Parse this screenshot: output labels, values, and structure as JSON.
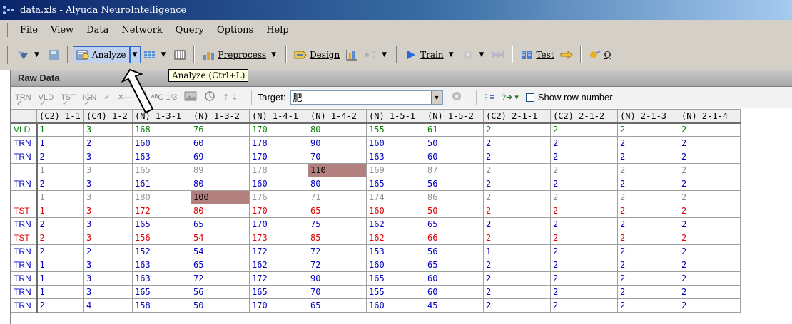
{
  "window": {
    "title": "data.xls - Alyuda NeuroIntelligence"
  },
  "menu": [
    "File",
    "View",
    "Data",
    "Network",
    "Query",
    "Options",
    "Help"
  ],
  "toolbar": {
    "analyze_label": "Analyze",
    "preprocess_label": "Preprocess",
    "design_label": "Design",
    "train_label": "Train",
    "test_label": "Test",
    "query_label": "Q"
  },
  "tooltip": "Analyze (Ctrl+L)",
  "panel": {
    "title": "Raw Data",
    "tool_labels": [
      "TRN",
      "VLD",
      "TST",
      "IGN"
    ],
    "target_label": "Target:",
    "target_value": "肥",
    "show_row_numbers_label": "Show row number"
  },
  "columns": [
    "(C2) 1-1",
    "(C4) 1-2",
    "(N) 1-3-1",
    "(N) 1-3-2",
    "(N) 1-4-1",
    "(N) 1-4-2",
    "(N) 1-5-1",
    "(N) 1-5-2",
    "(C2) 2-1-1",
    "(C2) 2-1-2",
    "(N) 2-1-3",
    "(N) 2-1-4"
  ],
  "rows": [
    {
      "label": "VLD",
      "set": "vld",
      "cells": [
        "1",
        "3",
        "168",
        "76",
        "170",
        "80",
        "155",
        "61",
        "2",
        "2",
        "2",
        "2"
      ]
    },
    {
      "label": "TRN",
      "set": "trn",
      "cells": [
        "1",
        "2",
        "160",
        "60",
        "178",
        "90",
        "160",
        "50",
        "2",
        "2",
        "2",
        "2"
      ]
    },
    {
      "label": "TRN",
      "set": "trn",
      "cells": [
        "2",
        "3",
        "163",
        "69",
        "170",
        "70",
        "163",
        "60",
        "2",
        "2",
        "2",
        "2"
      ]
    },
    {
      "label": "",
      "set": "none",
      "highlight": 5,
      "cells": [
        "1",
        "3",
        "165",
        "89",
        "178",
        "110",
        "169",
        "87",
        "2",
        "2",
        "2",
        "2"
      ]
    },
    {
      "label": "TRN",
      "set": "trn",
      "cells": [
        "2",
        "3",
        "161",
        "80",
        "160",
        "80",
        "165",
        "56",
        "2",
        "2",
        "2",
        "2"
      ]
    },
    {
      "label": "",
      "set": "none",
      "highlight": 3,
      "cells": [
        "1",
        "3",
        "180",
        "100",
        "176",
        "71",
        "174",
        "86",
        "2",
        "2",
        "2",
        "2"
      ]
    },
    {
      "label": "TST",
      "set": "tst",
      "cells": [
        "1",
        "3",
        "172",
        "80",
        "170",
        "65",
        "160",
        "50",
        "2",
        "2",
        "2",
        "2"
      ]
    },
    {
      "label": "TRN",
      "set": "trn",
      "cells": [
        "2",
        "3",
        "165",
        "65",
        "170",
        "75",
        "162",
        "65",
        "2",
        "2",
        "2",
        "2"
      ]
    },
    {
      "label": "TST",
      "set": "tst",
      "cells": [
        "2",
        "3",
        "156",
        "54",
        "173",
        "85",
        "162",
        "66",
        "2",
        "2",
        "2",
        "2"
      ]
    },
    {
      "label": "TRN",
      "set": "trn",
      "cells": [
        "2",
        "2",
        "152",
        "54",
        "172",
        "72",
        "153",
        "56",
        "1",
        "2",
        "2",
        "2"
      ]
    },
    {
      "label": "TRN",
      "set": "trn",
      "cells": [
        "1",
        "3",
        "163",
        "65",
        "162",
        "72",
        "160",
        "65",
        "2",
        "2",
        "2",
        "2"
      ]
    },
    {
      "label": "TRN",
      "set": "trn",
      "cells": [
        "1",
        "3",
        "163",
        "72",
        "172",
        "90",
        "165",
        "60",
        "2",
        "2",
        "2",
        "2"
      ]
    },
    {
      "label": "TRN",
      "set": "trn",
      "cells": [
        "1",
        "3",
        "165",
        "56",
        "165",
        "70",
        "155",
        "60",
        "2",
        "2",
        "2",
        "2"
      ]
    },
    {
      "label": "TRN",
      "set": "trn",
      "cells": [
        "2",
        "4",
        "158",
        "50",
        "170",
        "65",
        "160",
        "45",
        "2",
        "2",
        "2",
        "2"
      ]
    }
  ],
  "colors": {
    "vld": "#008000",
    "trn": "#0000c0",
    "tst": "#e00000",
    "ignored": "#8f8f8f",
    "highlight": "#b38080"
  }
}
